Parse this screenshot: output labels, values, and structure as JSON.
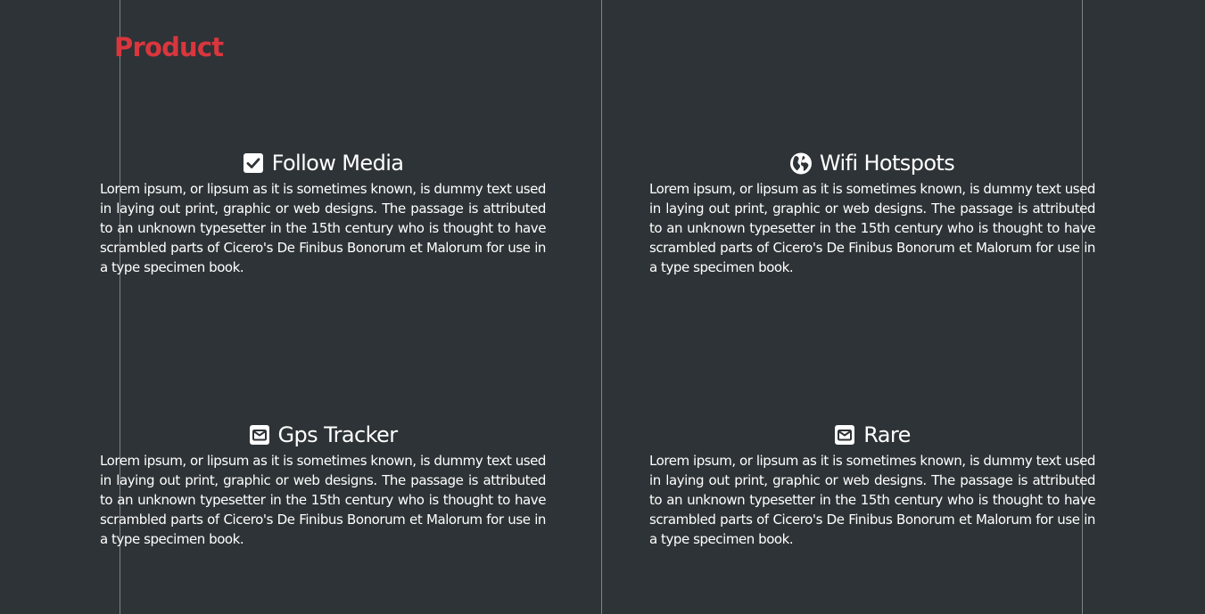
{
  "section": {
    "title": "Product"
  },
  "colors": {
    "background": "#2d3336",
    "accent": "#d9363e",
    "divider": "#7d8386",
    "text": "#ffffff"
  },
  "features": [
    {
      "icon": "check-square-icon",
      "title": "Follow Media",
      "text": "Lorem ipsum, or lipsum as it is sometimes known, is dummy text used in laying out print, graphic or web designs. The passage is attributed to an unknown typesetter in the 15th century who is thought to have scrambled parts of Cicero's De Finibus Bonorum et Malorum for use in a type specimen book."
    },
    {
      "icon": "globe-icon",
      "title": "Wifi Hotspots",
      "text": "Lorem ipsum, or lipsum as it is sometimes known, is dummy text used in laying out print, graphic or web designs. The passage is attributed to an unknown typesetter in the 15th century who is thought to have scrambled parts of Cicero's De Finibus Bonorum et Malorum for use in a type specimen book."
    },
    {
      "icon": "envelope-square-icon",
      "title": "Gps Tracker",
      "text": "Lorem ipsum, or lipsum as it is sometimes known, is dummy text used in laying out print, graphic or web designs. The passage is attributed to an unknown typesetter in the 15th century who is thought to have scrambled parts of Cicero's De Finibus Bonorum et Malorum for use in a type specimen book."
    },
    {
      "icon": "envelope-square-icon",
      "title": "Rare",
      "text": "Lorem ipsum, or lipsum as it is sometimes known, is dummy text used in laying out print, graphic or web designs. The passage is attributed to an unknown typesetter in the 15th century who is thought to have scrambled parts of Cicero's De Finibus Bonorum et Malorum for use in a type specimen book."
    }
  ]
}
